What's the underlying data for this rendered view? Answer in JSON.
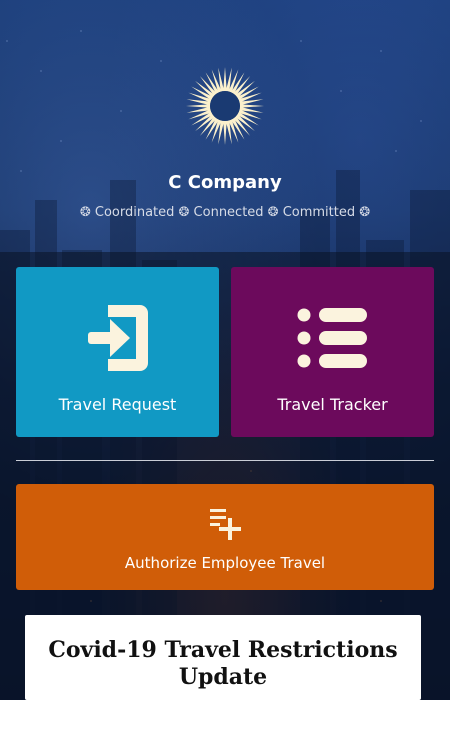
{
  "header": {
    "company_name": "C Company",
    "tagline": "❂ Coordinated ❂ Connected ❂ Committed ❂",
    "logo_icon": "sunburst-logo-icon"
  },
  "tiles": {
    "travel_request": {
      "label": "Travel Request",
      "icon": "sign-in-icon",
      "color": "#1199c4"
    },
    "travel_tracker": {
      "label": "Travel Tracker",
      "icon": "list-icon",
      "color": "#6c0a5c"
    },
    "authorize_travel": {
      "label": "Authorize Employee Travel",
      "icon": "playlist-add-icon",
      "color": "#d05d08"
    }
  },
  "notice": {
    "title": "Covid-19 Travel Restrictions Update"
  },
  "colors": {
    "icon_fill": "#fbf3de",
    "logo": "#fbf0cc"
  }
}
